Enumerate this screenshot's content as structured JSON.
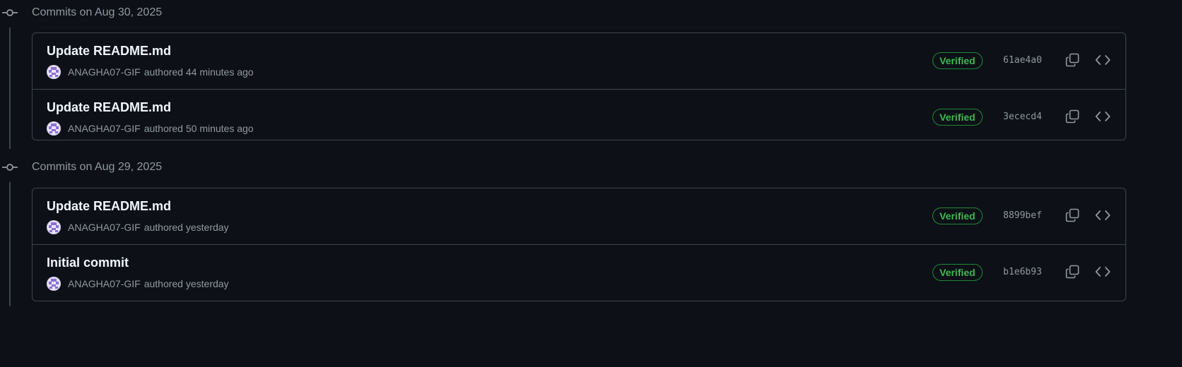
{
  "groups": [
    {
      "title": "Commits on Aug 30, 2025",
      "commits": [
        {
          "message": "Update README.md",
          "author": "ANAGHA07-GIF",
          "authored": "authored 44 minutes ago",
          "verified": "Verified",
          "sha": "61ae4a0"
        },
        {
          "message": "Update README.md",
          "author": "ANAGHA07-GIF",
          "authored": "authored 50 minutes ago",
          "verified": "Verified",
          "sha": "3ececd4"
        }
      ]
    },
    {
      "title": "Commits on Aug 29, 2025",
      "commits": [
        {
          "message": "Update README.md",
          "author": "ANAGHA07-GIF",
          "authored": "authored yesterday",
          "verified": "Verified",
          "sha": "8899bef"
        },
        {
          "message": "Initial commit",
          "author": "ANAGHA07-GIF",
          "authored": "authored yesterday",
          "verified": "Verified",
          "sha": "b1e6b93"
        }
      ]
    }
  ],
  "icons": {
    "commit_node": "git-commit-icon",
    "copy": "copy-icon",
    "browse": "code-icon"
  },
  "colors": {
    "background": "#0d1117",
    "border": "#3d444d",
    "verified_text": "#3fb950",
    "verified_border": "#238636",
    "muted_text": "#9198a1"
  }
}
